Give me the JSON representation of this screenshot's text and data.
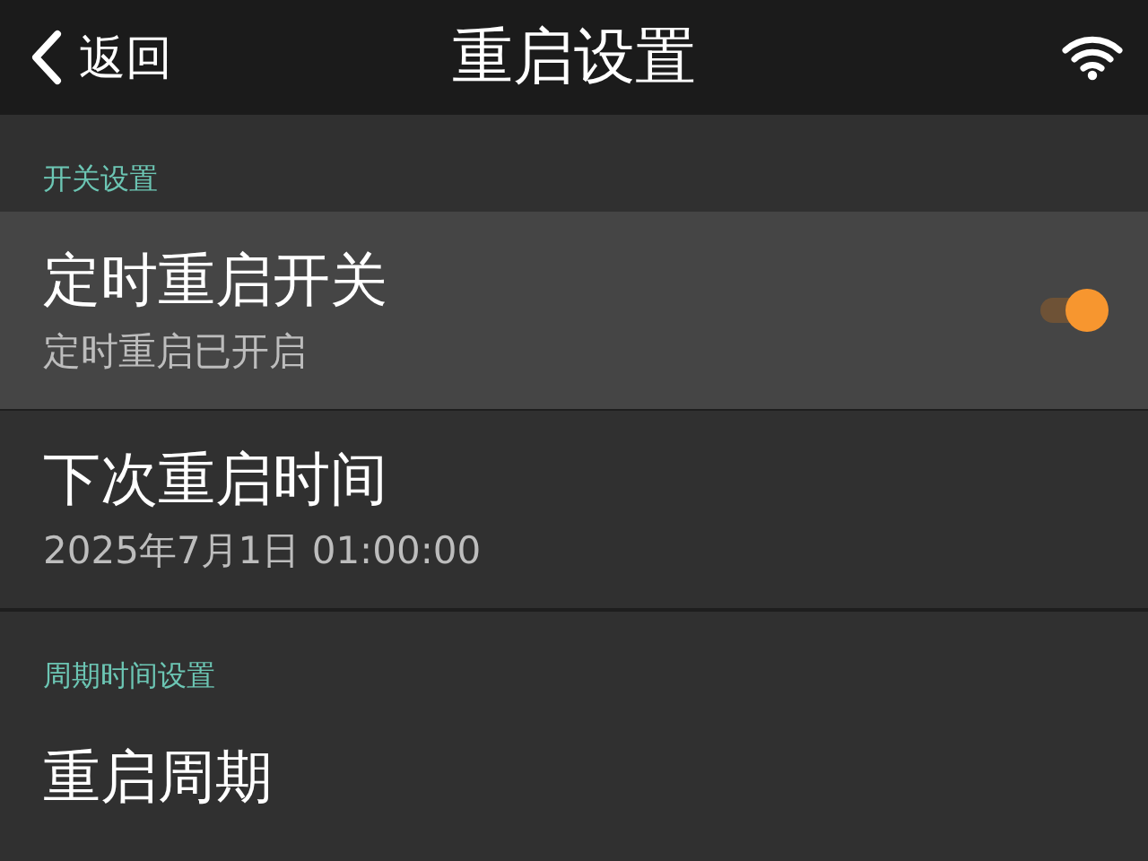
{
  "top_bar": {
    "back_label": "返回",
    "title": "重启设置"
  },
  "sections": [
    {
      "header": "开关设置",
      "rows": [
        {
          "kind": "switch",
          "title": "定时重启开关",
          "subtitle": "定时重启已开启",
          "on": true,
          "selected": true
        },
        {
          "kind": "info",
          "title": "下次重启时间",
          "subtitle": "2025年7月1日 01:00:00",
          "selected": false
        }
      ]
    },
    {
      "header": "周期时间设置",
      "rows": [
        {
          "kind": "info",
          "title": "重启周期",
          "selected": false
        }
      ]
    }
  ]
}
